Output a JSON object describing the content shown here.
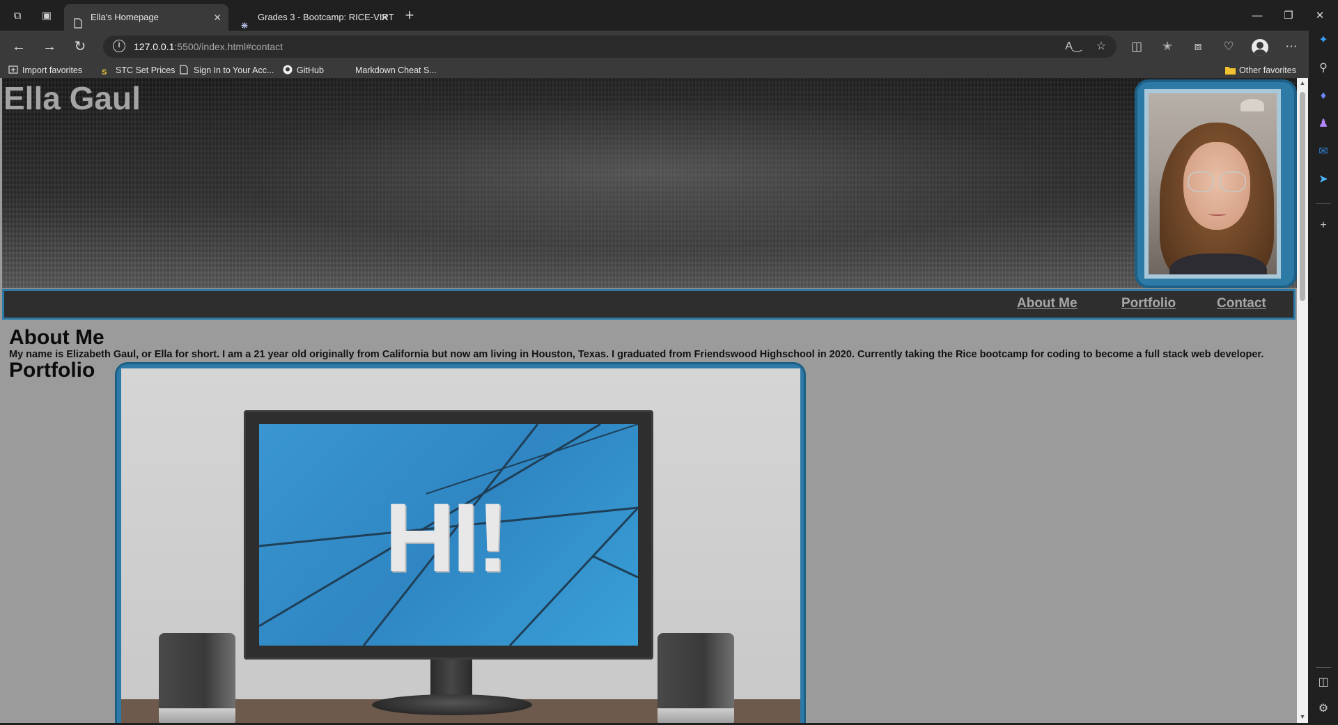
{
  "browser": {
    "tabs": [
      {
        "label": "Ella's Homepage",
        "active": true
      },
      {
        "label": "Grades 3 - Bootcamp: RICE-VIRT",
        "active": false
      }
    ],
    "url_host": "127.0.0.1",
    "url_rest": ":5500/index.html#contact",
    "favorites": [
      {
        "label": "Import favorites"
      },
      {
        "label": "STC Set Prices"
      },
      {
        "label": "Sign In to Your Acc..."
      },
      {
        "label": "GitHub"
      },
      {
        "label": "Markdown Cheat S..."
      }
    ],
    "other_favorites": "Other favorites"
  },
  "page": {
    "title": "Ella Gaul",
    "nav": [
      "About Me",
      "Portfolio",
      "Contact"
    ],
    "about_heading": "About Me",
    "about_text": "My name is Elizabeth Gaul, or Ella for short. I am a 21 year old originally from California but now am living in Houston, Texas. I graduated from Friendswood Highschool in 2020. Currently taking the Rice bootcamp for coding to become a full stack web developer.",
    "portfolio_heading": "Portfolio",
    "project_image_text": "HI!"
  },
  "colors": {
    "accent_blue": "#2d7aa6",
    "page_background": "#9b9b9b",
    "navbar_background": "#2e2e2e"
  }
}
